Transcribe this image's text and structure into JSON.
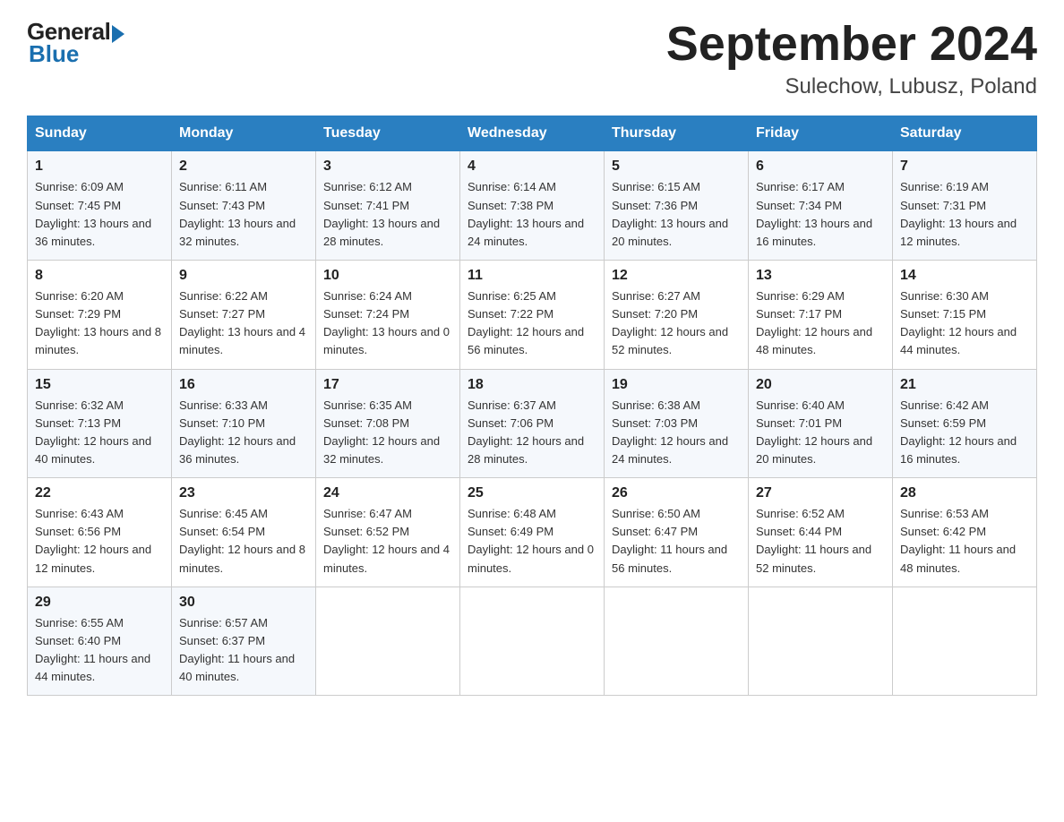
{
  "header": {
    "logo": {
      "general": "General",
      "blue": "Blue"
    },
    "title": "September 2024",
    "location": "Sulechow, Lubusz, Poland"
  },
  "weekdays": [
    "Sunday",
    "Monday",
    "Tuesday",
    "Wednesday",
    "Thursday",
    "Friday",
    "Saturday"
  ],
  "weeks": [
    [
      {
        "day": "1",
        "sunrise": "6:09 AM",
        "sunset": "7:45 PM",
        "daylight": "13 hours and 36 minutes."
      },
      {
        "day": "2",
        "sunrise": "6:11 AM",
        "sunset": "7:43 PM",
        "daylight": "13 hours and 32 minutes."
      },
      {
        "day": "3",
        "sunrise": "6:12 AM",
        "sunset": "7:41 PM",
        "daylight": "13 hours and 28 minutes."
      },
      {
        "day": "4",
        "sunrise": "6:14 AM",
        "sunset": "7:38 PM",
        "daylight": "13 hours and 24 minutes."
      },
      {
        "day": "5",
        "sunrise": "6:15 AM",
        "sunset": "7:36 PM",
        "daylight": "13 hours and 20 minutes."
      },
      {
        "day": "6",
        "sunrise": "6:17 AM",
        "sunset": "7:34 PM",
        "daylight": "13 hours and 16 minutes."
      },
      {
        "day": "7",
        "sunrise": "6:19 AM",
        "sunset": "7:31 PM",
        "daylight": "13 hours and 12 minutes."
      }
    ],
    [
      {
        "day": "8",
        "sunrise": "6:20 AM",
        "sunset": "7:29 PM",
        "daylight": "13 hours and 8 minutes."
      },
      {
        "day": "9",
        "sunrise": "6:22 AM",
        "sunset": "7:27 PM",
        "daylight": "13 hours and 4 minutes."
      },
      {
        "day": "10",
        "sunrise": "6:24 AM",
        "sunset": "7:24 PM",
        "daylight": "13 hours and 0 minutes."
      },
      {
        "day": "11",
        "sunrise": "6:25 AM",
        "sunset": "7:22 PM",
        "daylight": "12 hours and 56 minutes."
      },
      {
        "day": "12",
        "sunrise": "6:27 AM",
        "sunset": "7:20 PM",
        "daylight": "12 hours and 52 minutes."
      },
      {
        "day": "13",
        "sunrise": "6:29 AM",
        "sunset": "7:17 PM",
        "daylight": "12 hours and 48 minutes."
      },
      {
        "day": "14",
        "sunrise": "6:30 AM",
        "sunset": "7:15 PM",
        "daylight": "12 hours and 44 minutes."
      }
    ],
    [
      {
        "day": "15",
        "sunrise": "6:32 AM",
        "sunset": "7:13 PM",
        "daylight": "12 hours and 40 minutes."
      },
      {
        "day": "16",
        "sunrise": "6:33 AM",
        "sunset": "7:10 PM",
        "daylight": "12 hours and 36 minutes."
      },
      {
        "day": "17",
        "sunrise": "6:35 AM",
        "sunset": "7:08 PM",
        "daylight": "12 hours and 32 minutes."
      },
      {
        "day": "18",
        "sunrise": "6:37 AM",
        "sunset": "7:06 PM",
        "daylight": "12 hours and 28 minutes."
      },
      {
        "day": "19",
        "sunrise": "6:38 AM",
        "sunset": "7:03 PM",
        "daylight": "12 hours and 24 minutes."
      },
      {
        "day": "20",
        "sunrise": "6:40 AM",
        "sunset": "7:01 PM",
        "daylight": "12 hours and 20 minutes."
      },
      {
        "day": "21",
        "sunrise": "6:42 AM",
        "sunset": "6:59 PM",
        "daylight": "12 hours and 16 minutes."
      }
    ],
    [
      {
        "day": "22",
        "sunrise": "6:43 AM",
        "sunset": "6:56 PM",
        "daylight": "12 hours and 12 minutes."
      },
      {
        "day": "23",
        "sunrise": "6:45 AM",
        "sunset": "6:54 PM",
        "daylight": "12 hours and 8 minutes."
      },
      {
        "day": "24",
        "sunrise": "6:47 AM",
        "sunset": "6:52 PM",
        "daylight": "12 hours and 4 minutes."
      },
      {
        "day": "25",
        "sunrise": "6:48 AM",
        "sunset": "6:49 PM",
        "daylight": "12 hours and 0 minutes."
      },
      {
        "day": "26",
        "sunrise": "6:50 AM",
        "sunset": "6:47 PM",
        "daylight": "11 hours and 56 minutes."
      },
      {
        "day": "27",
        "sunrise": "6:52 AM",
        "sunset": "6:44 PM",
        "daylight": "11 hours and 52 minutes."
      },
      {
        "day": "28",
        "sunrise": "6:53 AM",
        "sunset": "6:42 PM",
        "daylight": "11 hours and 48 minutes."
      }
    ],
    [
      {
        "day": "29",
        "sunrise": "6:55 AM",
        "sunset": "6:40 PM",
        "daylight": "11 hours and 44 minutes."
      },
      {
        "day": "30",
        "sunrise": "6:57 AM",
        "sunset": "6:37 PM",
        "daylight": "11 hours and 40 minutes."
      },
      null,
      null,
      null,
      null,
      null
    ]
  ]
}
